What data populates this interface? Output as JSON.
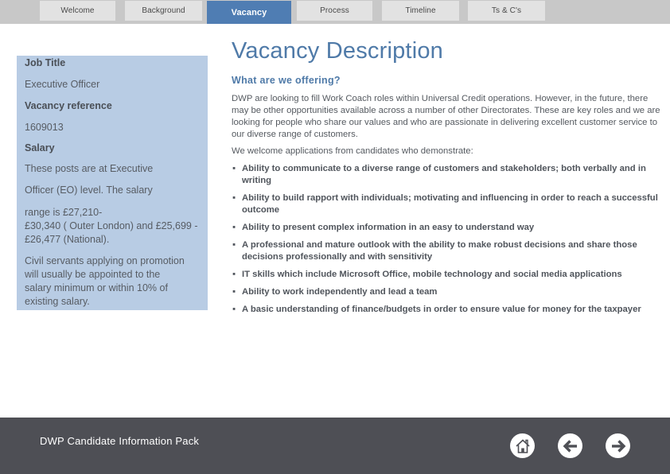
{
  "tabs": [
    {
      "label": "Welcome",
      "active": false
    },
    {
      "label": "Background",
      "active": false
    },
    {
      "label": "Vacancy",
      "active": true
    },
    {
      "label": "Process",
      "active": false
    },
    {
      "label": "Timeline",
      "active": false
    },
    {
      "label": "Ts & C's",
      "active": false
    }
  ],
  "sidebar": {
    "job_title_label": "Job Title",
    "job_title_value": "Executive Officer",
    "reference_label": "Vacancy reference",
    "reference_value": "1609013",
    "salary_label": "Salary",
    "salary_line1": "These posts are at Executive",
    "salary_line2": "Officer (EO) level. The salary",
    "salary_line3": "range is £27,210-",
    "salary_line4": "£30,340 ( Outer London) and £25,699 -",
    "salary_line5": "£26,477 (National).",
    "promotion_line1": "Civil servants applying on promotion",
    "promotion_line2": "will usually be appointed to the",
    "promotion_line3": "salary minimum or within 10% of",
    "promotion_line4": "existing salary."
  },
  "main": {
    "title": "Vacancy Description",
    "subtitle": "What are we offering?",
    "intro": "DWP are looking to fill Work Coach roles within Universal Credit operations.  However, in the future, there may be other opportunities available across a number of other Directorates. These are key roles and we are looking for people who share our values and who are passionate in delivering excellent customer service to our diverse range of customers.",
    "welcome": "We welcome applications from candidates who demonstrate:",
    "bullet_glyph": "▪",
    "bullets": [
      "Ability to communicate to a diverse range of customers and stakeholders; both verbally and in writing",
      "Ability to build rapport with individuals; motivating and influencing in order to reach a successful outcome",
      "Ability to present complex information in an easy to understand way",
      "A professional and mature outlook with the ability to make robust decisions and share those decisions professionally and with sensitivity",
      "IT skills which include Microsoft Office, mobile technology and social media applications",
      "Ability to work independently and lead a team",
      "A basic understanding of finance/budgets in order to ensure value for money for the taxpayer"
    ]
  },
  "footer": {
    "label": "DWP Candidate Information Pack",
    "nav": [
      {
        "icon": "home-icon",
        "label": "Home"
      },
      {
        "icon": "arrow-left-icon",
        "label": "Back"
      },
      {
        "icon": "arrow-right-icon",
        "label": "Next"
      }
    ]
  },
  "colors": {
    "accent": "#4f7db3",
    "sidebar_bg": "#b8cce4",
    "footer_bg": "#4e4f55",
    "tab_bg": "#e2e2e2",
    "topbar_bg": "#c8c8c8"
  }
}
